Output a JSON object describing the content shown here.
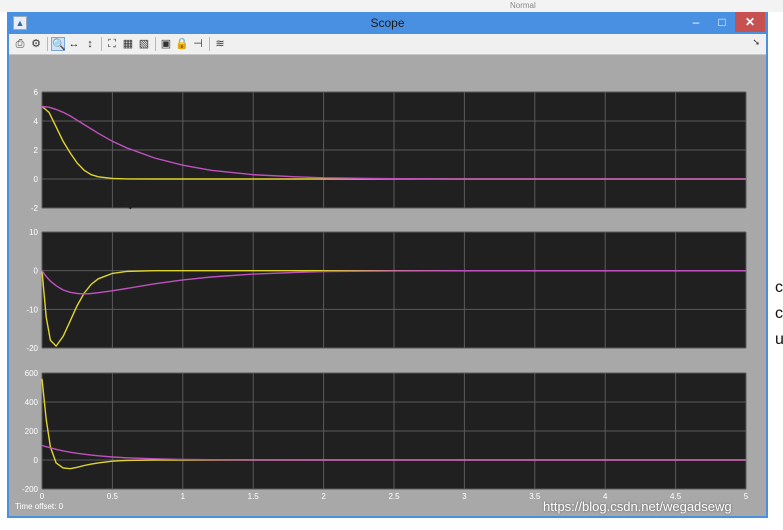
{
  "background": {
    "style_label": "Normal",
    "right_text": [
      "c",
      "c",
      "u"
    ]
  },
  "window": {
    "title": "Scope",
    "min_label": "–",
    "max_label": "□",
    "close_label": "✕"
  },
  "toolbar": {
    "icons": [
      "print-icon",
      "settings-icon",
      "zoom-icon",
      "zoom-x-icon",
      "zoom-y-icon",
      "autoscale-icon",
      "save-axes-icon",
      "restore-axes-icon",
      "floating-scope-icon",
      "lock-icon",
      "signal-selection-icon",
      "legend-icon"
    ]
  },
  "status": {
    "time_offset": "Time offset:  0"
  },
  "watermark": "https://blog.csdn.net/wegadsewg",
  "colors": {
    "plot_bg": "#202020",
    "frame_bg": "#a8a8a8",
    "grid": "#5a5a5a",
    "yellow": "#e0d430",
    "magenta": "#c050c0"
  },
  "chart_data": [
    {
      "type": "line",
      "x": [
        0,
        0.05,
        0.1,
        0.15,
        0.2,
        0.25,
        0.3,
        0.35,
        0.4,
        0.5,
        0.6,
        0.8,
        1.0,
        1.2,
        1.5,
        1.8,
        2.0,
        2.5,
        3.0,
        4.0,
        5.0
      ],
      "xlim": [
        0,
        5
      ],
      "ylim": [
        -2,
        6
      ],
      "yticks": [
        "6",
        "4",
        "2",
        "0",
        "-2"
      ],
      "series": [
        {
          "color": "#e0d430",
          "values": [
            5.0,
            4.6,
            3.6,
            2.6,
            1.8,
            1.1,
            0.6,
            0.3,
            0.15,
            0.04,
            0.01,
            0,
            0,
            0,
            0,
            0,
            0,
            0,
            0,
            0,
            0
          ]
        },
        {
          "color": "#c050c0",
          "values": [
            5.0,
            4.95,
            4.8,
            4.6,
            4.35,
            4.05,
            3.75,
            3.45,
            3.15,
            2.6,
            2.15,
            1.45,
            0.95,
            0.6,
            0.3,
            0.15,
            0.08,
            0.02,
            0,
            0,
            0
          ]
        }
      ]
    },
    {
      "type": "line",
      "x": [
        0,
        0.03,
        0.06,
        0.1,
        0.15,
        0.2,
        0.25,
        0.3,
        0.35,
        0.4,
        0.5,
        0.6,
        0.8,
        1.0,
        1.2,
        1.5,
        1.8,
        2.0,
        2.5,
        3.0,
        4.0,
        5.0
      ],
      "xlim": [
        0,
        5
      ],
      "ylim": [
        -20,
        10
      ],
      "yticks": [
        "10",
        "0",
        "-10",
        "-20"
      ],
      "series": [
        {
          "color": "#e0d430",
          "values": [
            0,
            -12,
            -18,
            -19.5,
            -17,
            -13,
            -9,
            -5.8,
            -3.5,
            -2.1,
            -0.7,
            -0.2,
            0,
            0,
            0,
            0,
            0,
            0,
            0,
            0,
            0,
            0
          ]
        },
        {
          "color": "#c050c0",
          "values": [
            0,
            -1.5,
            -2.7,
            -3.9,
            -5.0,
            -5.6,
            -5.9,
            -6.0,
            -5.9,
            -5.7,
            -5.2,
            -4.6,
            -3.4,
            -2.4,
            -1.65,
            -0.9,
            -0.45,
            -0.25,
            -0.05,
            0,
            0,
            0
          ]
        }
      ]
    },
    {
      "type": "line",
      "x": [
        0,
        0.03,
        0.06,
        0.1,
        0.15,
        0.2,
        0.25,
        0.3,
        0.35,
        0.4,
        0.5,
        0.6,
        0.8,
        1.0,
        1.2,
        1.5,
        2.0,
        2.5,
        3.0,
        4.0,
        5.0
      ],
      "xlim": [
        0,
        5
      ],
      "ylim": [
        -200,
        600
      ],
      "xticks": [
        "0",
        "0.5",
        "1",
        "1.5",
        "2",
        "2.5",
        "3",
        "3.5",
        "4",
        "4.5",
        "5"
      ],
      "yticks": [
        "600",
        "400",
        "200",
        "0",
        "-200"
      ],
      "series": [
        {
          "color": "#e0d430",
          "values": [
            560,
            280,
            90,
            -20,
            -55,
            -60,
            -50,
            -38,
            -28,
            -20,
            -8,
            -3,
            0,
            0,
            0,
            0,
            0,
            0,
            0,
            0,
            0
          ]
        },
        {
          "color": "#c050c0",
          "values": [
            100,
            92,
            84,
            74,
            63,
            54,
            46,
            40,
            34,
            29,
            21,
            15,
            8,
            4,
            2,
            0.5,
            0,
            0,
            0,
            0,
            0
          ]
        }
      ]
    }
  ]
}
